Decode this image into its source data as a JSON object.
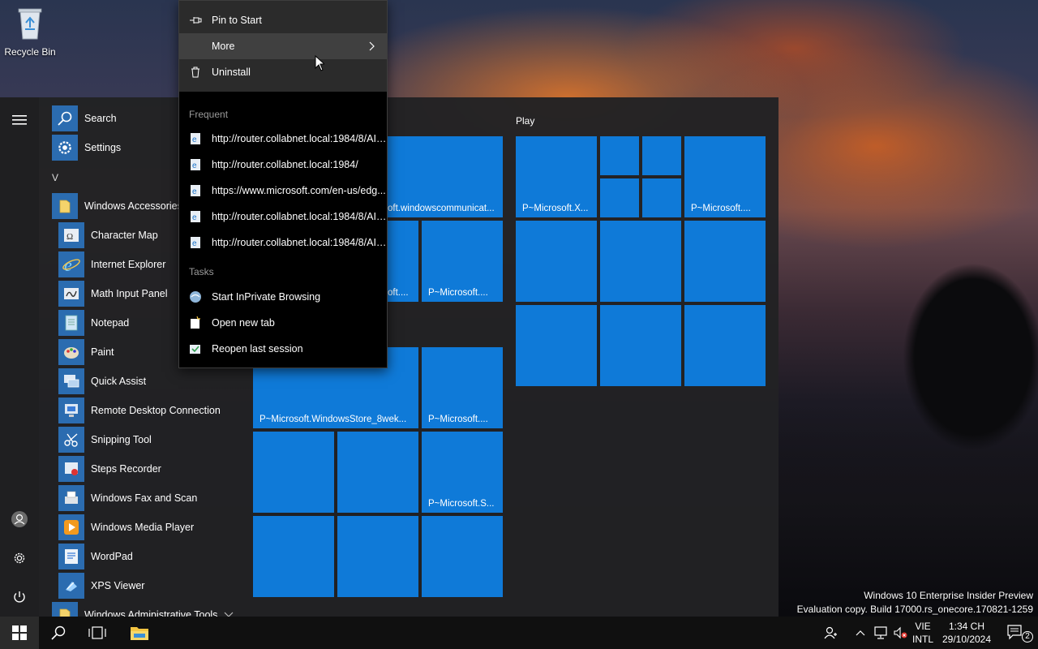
{
  "desktop": {
    "recycle_bin_label": "Recycle Bin"
  },
  "start_menu": {
    "pinned_top": [
      {
        "label": "Search",
        "icon": "search-icon"
      },
      {
        "label": "Settings",
        "icon": "gear-icon"
      }
    ],
    "letter_header": "V",
    "folder": {
      "label": "Windows Accessories",
      "icon": "folder-icon"
    },
    "apps": [
      {
        "label": "Character Map",
        "icon": "character-map-icon"
      },
      {
        "label": "Internet Explorer",
        "icon": "internet-explorer-icon"
      },
      {
        "label": "Math Input Panel",
        "icon": "math-input-icon"
      },
      {
        "label": "Notepad",
        "icon": "notepad-icon"
      },
      {
        "label": "Paint",
        "icon": "paint-icon"
      },
      {
        "label": "Quick Assist",
        "icon": "quick-assist-icon"
      },
      {
        "label": "Remote Desktop Connection",
        "icon": "remote-desktop-icon"
      },
      {
        "label": "Snipping Tool",
        "icon": "snipping-tool-icon"
      },
      {
        "label": "Steps Recorder",
        "icon": "steps-recorder-icon"
      },
      {
        "label": "Windows Fax and Scan",
        "icon": "fax-scan-icon"
      },
      {
        "label": "Windows Media Player",
        "icon": "media-player-icon"
      },
      {
        "label": "WordPad",
        "icon": "wordpad-icon"
      },
      {
        "label": "XPS Viewer",
        "icon": "xps-viewer-icon"
      }
    ],
    "folder_bottom": {
      "label": "Windows Administrative Tools",
      "icon": "folder-icon"
    },
    "play_group_title": "Play",
    "tiles_left": [
      {
        "label": "oft.windowscommunicat..."
      },
      {
        "label": "oft...."
      },
      {
        "label": "P~Microsoft...."
      },
      {
        "label": "P~Microsoft.WindowsStore_8wek..."
      },
      {
        "label": "P~Microsoft...."
      },
      {
        "label": ""
      },
      {
        "label": ""
      },
      {
        "label": "P~Microsoft.S..."
      },
      {
        "label": ""
      },
      {
        "label": ""
      },
      {
        "label": ""
      }
    ],
    "tiles_play": [
      {
        "label": "P~Microsoft.X..."
      },
      {
        "label": "P~Microsoft...."
      }
    ]
  },
  "context_menu": {
    "actions": [
      {
        "label": "Pin to Start",
        "icon": "pin-icon"
      },
      {
        "label": "More",
        "icon": "chevron-right-icon"
      },
      {
        "label": "Uninstall",
        "icon": "trash-icon"
      }
    ],
    "frequent_header": "Frequent",
    "frequent": [
      "http://router.collabnet.local:1984/8/AIB...",
      "http://router.collabnet.local:1984/",
      "https://www.microsoft.com/en-us/edg...",
      "http://router.collabnet.local:1984/8/AIB...",
      "http://router.collabnet.local:1984/8/AIB..."
    ],
    "tasks_header": "Tasks",
    "tasks": [
      {
        "label": "Start InPrivate Browsing",
        "icon": "inprivate-icon"
      },
      {
        "label": "Open new tab",
        "icon": "new-tab-icon"
      },
      {
        "label": "Reopen last session",
        "icon": "reopen-session-icon"
      }
    ]
  },
  "watermark": {
    "line1": "Windows 10 Enterprise Insider Preview",
    "line2": "Evaluation copy. Build 17000.rs_onecore.170821-1259"
  },
  "taskbar": {
    "language_top": "VIE",
    "language_bottom": "INTL",
    "time": "1:34 CH",
    "date": "29/10/2024",
    "notification_count": "2"
  },
  "colors": {
    "accent": "#0f7ad8",
    "menu_bg": "#222224",
    "context_top_bg": "#2b2b2b",
    "context_bottom_bg": "#000000",
    "taskbar_bg": "#101010"
  }
}
